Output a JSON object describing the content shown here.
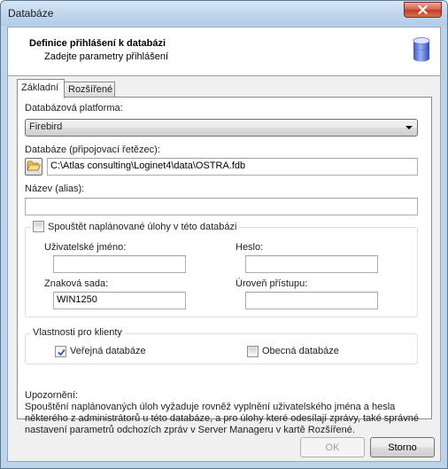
{
  "window": {
    "title": "Databáze"
  },
  "header": {
    "title": "Definice přihlášení k databázi",
    "subtitle": "Zadejte parametry přihlášení"
  },
  "tabs": [
    {
      "label": "Základní",
      "active": true
    },
    {
      "label": "Rozšířené",
      "active": false
    }
  ],
  "form": {
    "platform_label": "Databázová platforma:",
    "platform_value": "Firebird",
    "connection_label": "Databáze (připojovací řetězec):",
    "connection_value": "C:\\Atlas consulting\\Loginet4\\data\\OSTRA.fdb",
    "alias_label": "Název (alias):",
    "alias_value": ""
  },
  "scheduled": {
    "checkbox_label": "Spouštět naplánované úlohy v této databázi",
    "checked": false,
    "username_label": "Uživatelské jméno:",
    "username_value": "",
    "password_label": "Heslo:",
    "password_value": "",
    "charset_label": "Znaková sada:",
    "charset_value": "WIN1250",
    "access_label": "Úroveň přístupu:",
    "access_value": ""
  },
  "client_props": {
    "legend": "Vlastnosti pro klienty",
    "public_label": "Veřejná databáze",
    "public_checked": true,
    "common_label": "Obecná databáze",
    "common_checked": false
  },
  "note": {
    "title": "Upozornění:",
    "text": "Spouštění naplánovaných úloh vyžaduje rovněž vyplnění uživatelského jména a hesla některého z administrátorů u této databáze, a pro úlohy které odesílají zprávy, také správné nastavení parametrů odchozích zpráv v Server Manageru v kartě Rozšířené."
  },
  "buttons": {
    "ok_label": "OK",
    "ok_enabled": false,
    "cancel_label": "Storno"
  },
  "icons": {
    "close": "close-icon",
    "database": "database-icon",
    "folder": "folder-open-icon",
    "dropdown": "chevron-down-icon",
    "check": "checkmark-icon"
  },
  "colors": {
    "titlebar": "#c1d7ee",
    "close_button": "#c23a23",
    "dialog_background": "#f0f0f0",
    "panel_background": "#ffffff",
    "disabled_text": "#a0a0a0"
  }
}
